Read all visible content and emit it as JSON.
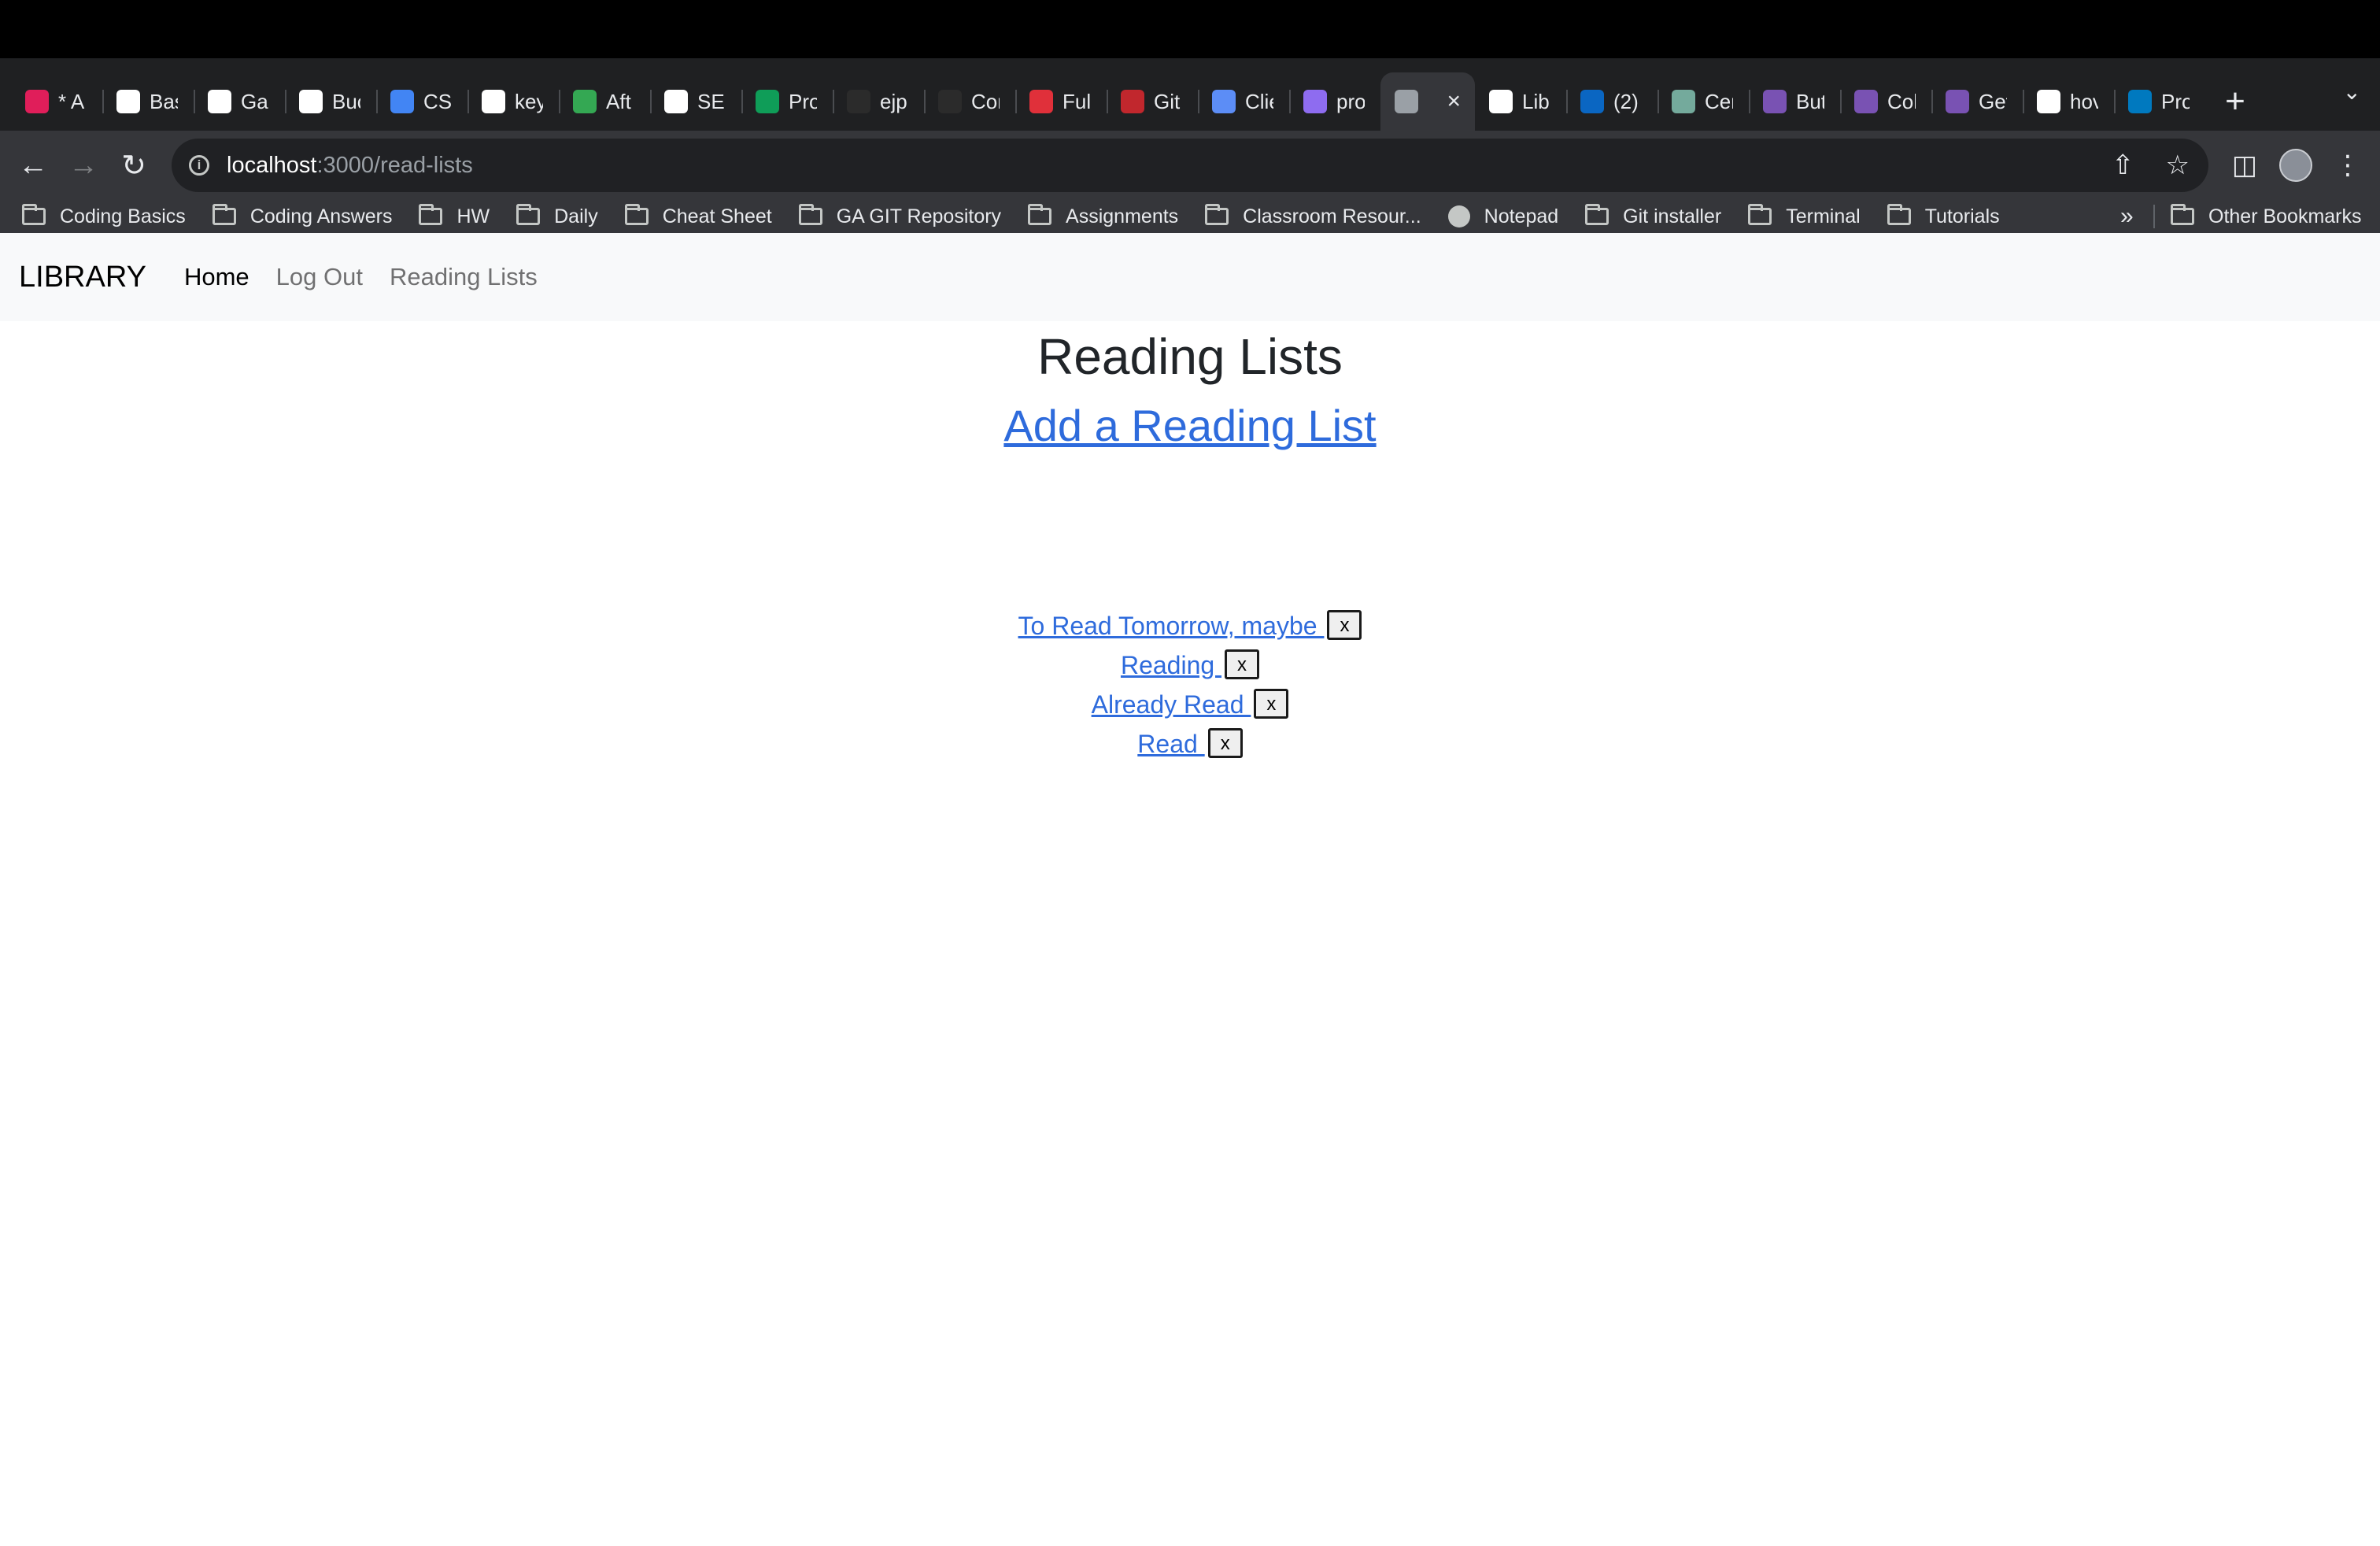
{
  "browser": {
    "tabs": [
      {
        "title": "* A",
        "icon": "slack-icon",
        "color": "#e01e5a"
      },
      {
        "title": "Bas",
        "icon": "github-icon",
        "color": "#ffffff"
      },
      {
        "title": "Gal",
        "icon": "globe-icon",
        "color": "#ffffff"
      },
      {
        "title": "Buc",
        "icon": "globe-icon",
        "color": "#ffffff"
      },
      {
        "title": "CS",
        "icon": "docs-icon",
        "color": "#4285f4"
      },
      {
        "title": "key",
        "icon": "google-icon",
        "color": "#ffffff"
      },
      {
        "title": "Aft",
        "icon": "mountain-icon",
        "color": "#34a853"
      },
      {
        "title": "SEI",
        "icon": "github-icon",
        "color": "#ffffff"
      },
      {
        "title": "Pro",
        "icon": "sheets-icon",
        "color": "#0f9d58"
      },
      {
        "title": "ejp",
        "icon": "github-dark-icon",
        "color": "#2b2b2b"
      },
      {
        "title": "Cor",
        "icon": "github-dark-icon",
        "color": "#2b2b2b"
      },
      {
        "title": "Full",
        "icon": "ga-icon",
        "color": "#e0303a"
      },
      {
        "title": "Git",
        "icon": "tools-icon",
        "color": "#c1272d"
      },
      {
        "title": "Clie",
        "icon": "api-icon",
        "color": "#5c8df6"
      },
      {
        "title": "pro",
        "icon": "shield-icon",
        "color": "#8e6cf0"
      },
      {
        "title": "",
        "icon": "globe-icon",
        "color": "#9aa0a6",
        "active": true
      },
      {
        "title": "Lib",
        "icon": "globe-icon",
        "color": "#ffffff"
      },
      {
        "title": "(2)",
        "icon": "linkedin-icon",
        "color": "#0a66c2"
      },
      {
        "title": "Cer",
        "icon": "openai-icon",
        "color": "#74aa9c"
      },
      {
        "title": "But",
        "icon": "bootstrap-icon",
        "color": "#7952b3"
      },
      {
        "title": "Col",
        "icon": "bootstrap-icon",
        "color": "#7952b3"
      },
      {
        "title": "Get",
        "icon": "bootstrap-icon",
        "color": "#7952b3"
      },
      {
        "title": "hov",
        "icon": "google-icon",
        "color": "#ffffff"
      },
      {
        "title": "Pro",
        "icon": "trello-icon",
        "color": "#0079bf"
      }
    ],
    "active_tab_close": "×",
    "new_tab": "+",
    "url_host": "localhost",
    "url_path": ":3000/read-lists",
    "bookmarks": [
      {
        "label": "Coding Basics",
        "icon": "folder-icon"
      },
      {
        "label": "Coding Answers",
        "icon": "folder-icon"
      },
      {
        "label": "HW",
        "icon": "folder-icon"
      },
      {
        "label": "Daily",
        "icon": "folder-icon"
      },
      {
        "label": "Cheat Sheet",
        "icon": "folder-icon"
      },
      {
        "label": "GA GIT Repository",
        "icon": "folder-icon"
      },
      {
        "label": "Assignments",
        "icon": "folder-icon"
      },
      {
        "label": "Classroom Resour...",
        "icon": "folder-icon"
      },
      {
        "label": "Notepad",
        "icon": "globe-icon"
      },
      {
        "label": "Git installer",
        "icon": "folder-icon"
      },
      {
        "label": "Terminal",
        "icon": "folder-icon"
      },
      {
        "label": "Tutorials",
        "icon": "folder-icon"
      }
    ],
    "bookmarks_overflow": "»",
    "other_bookmarks": "Other Bookmarks"
  },
  "app": {
    "brand": "LIBRARY",
    "nav": [
      {
        "label": "Home",
        "active": true
      },
      {
        "label": "Log Out",
        "active": false
      },
      {
        "label": "Reading Lists",
        "active": false
      }
    ],
    "title": "Reading Lists",
    "add_link": "Add a Reading List",
    "lists": [
      {
        "name": "To Read Tomorrow, maybe ",
        "delete": "x"
      },
      {
        "name": "Reading ",
        "delete": "x"
      },
      {
        "name": "Already Read ",
        "delete": "x"
      },
      {
        "name": "Read ",
        "delete": "x"
      }
    ],
    "link_color": "#2e6bdc"
  }
}
